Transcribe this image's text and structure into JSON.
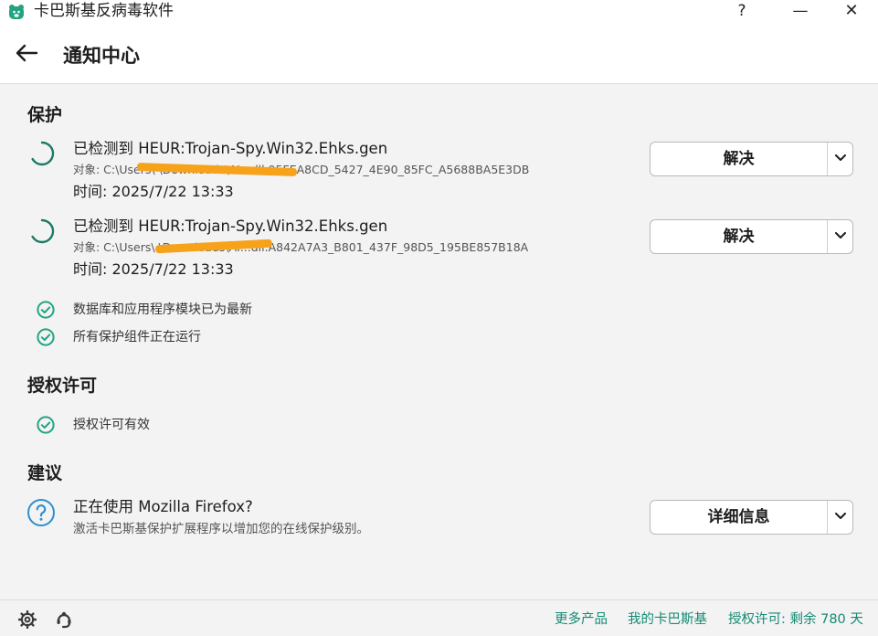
{
  "window": {
    "title": "卡巴斯基反病毒软件",
    "help_label": "?",
    "minimize_label": "—",
    "close_label": "✕"
  },
  "header": {
    "title": "通知中心"
  },
  "protection": {
    "title": "保护",
    "threats": [
      {
        "title": "已检测到 HEUR:Trojan-Spy.Win32.Ehks.gen",
        "object": "对象: C:\\Users\\        \\Downloads\\AI...dll.95FEA8CD_5427_4E90_85FC_A5688BA5E3DB",
        "time": "时间: 2025/7/22 13:33",
        "action_label": "解决"
      },
      {
        "title": "已检测到 HEUR:Trojan-Spy.Win32.Ehks.gen",
        "object": "对象: C:\\Users\\        \\Downloads\\AI...dll.A842A7A3_B801_437F_98D5_195BE857B18A",
        "time": "时间: 2025/7/22 13:33",
        "action_label": "解决"
      }
    ],
    "statuses": [
      "数据库和应用程序模块已为最新",
      "所有保护组件正在运行"
    ]
  },
  "license": {
    "title": "授权许可",
    "status": "授权许可有效"
  },
  "recommendations": {
    "title": "建议",
    "item_title": "正在使用 Mozilla Firefox?",
    "item_desc": "激活卡巴斯基保护扩展程序以增加您的在线保护级别。",
    "action_label": "详细信息"
  },
  "footer": {
    "more_products": "更多产品",
    "my_kaspersky": "我的卡巴斯基",
    "license_status": "授权许可: 剩余 780 天"
  },
  "colors": {
    "accent": "#148a74",
    "check": "#23a382",
    "redaction": "#f7a21b",
    "help_icon": "#2f8fcf"
  },
  "icons": {
    "app": "kaspersky-bear-icon",
    "back": "back-arrow-icon",
    "spinner": "loading-spinner-icon",
    "check": "check-circle-icon",
    "help": "question-circle-icon",
    "settings": "gear-icon",
    "support": "support-icon",
    "dropdown": "chevron-down-icon"
  }
}
